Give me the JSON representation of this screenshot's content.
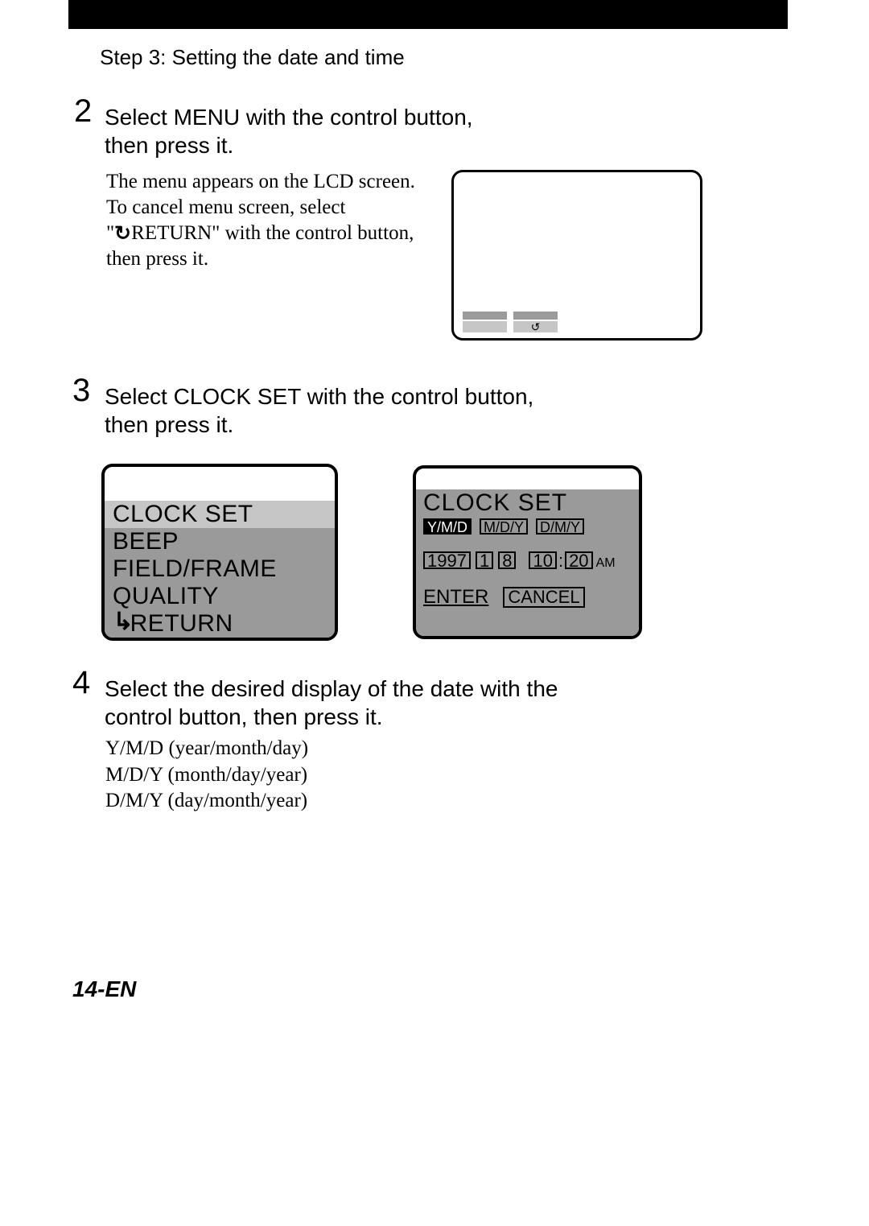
{
  "header": {
    "step_title": "Step 3: Setting the date and time"
  },
  "step2": {
    "number": "2",
    "instruction": "Select  MENU  with the control button, then press it.",
    "body_l1": "The menu appears on the LCD screen.",
    "body_l2": "To cancel menu screen, select",
    "body_l3a": "\"",
    "body_l3b": "RETURN\" with the control button, then press it."
  },
  "step3": {
    "number": "3",
    "instruction": "Select  CLOCK SET  with the control button, then press it.",
    "menu": {
      "items": [
        {
          "label": "CLOCK SET",
          "selected": true
        },
        {
          "label": "BEEP",
          "selected": false
        },
        {
          "label": "FIELD/FRAME",
          "selected": false
        },
        {
          "label": "QUALITY",
          "selected": false
        },
        {
          "label": "RETURN",
          "selected": false,
          "return_icon": true
        }
      ]
    },
    "clock": {
      "title": "CLOCK SET",
      "formats": [
        {
          "label": "Y/M/D",
          "selected": true
        },
        {
          "label": "M/D/Y",
          "selected": false
        },
        {
          "label": "D/M/Y",
          "selected": false
        }
      ],
      "date": {
        "year": "1997",
        "month": "1",
        "day": "8",
        "hour": "10",
        "minute": "20",
        "ampm": "AM"
      },
      "enter": "ENTER",
      "cancel": "CANCEL"
    }
  },
  "step4": {
    "number": "4",
    "instruction": "Select the desired display of the date with the control button, then press it.",
    "lines": [
      "Y/M/D  (year/month/day)",
      "M/D/Y  (month/day/year)",
      "D/M/Y  (day/month/year)"
    ]
  },
  "footer": {
    "page": "14-EN"
  }
}
